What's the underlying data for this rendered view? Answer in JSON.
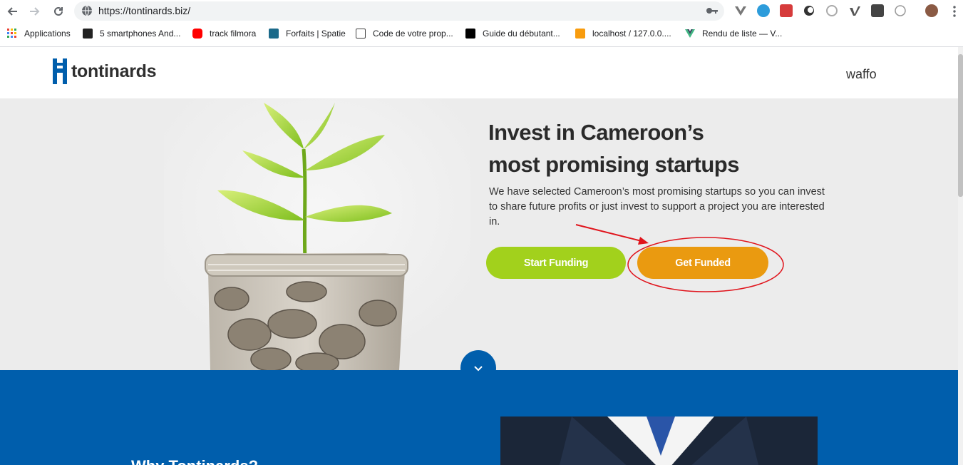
{
  "browser": {
    "url": "https://tontinards.biz/",
    "bookmarks": [
      {
        "label": "Applications",
        "color": "#e94235"
      },
      {
        "label": "5 smartphones And...",
        "color": "#222222"
      },
      {
        "label": "track filmora",
        "color": "#ff0000"
      },
      {
        "label": "Forfaits | Spatie",
        "color": "#1b6a8a"
      },
      {
        "label": "Code de votre prop...",
        "color": "#444444"
      },
      {
        "label": "Guide du débutant...",
        "color": "#000000"
      },
      {
        "label": "localhost / 127.0.0....",
        "color": "#f89c0e"
      },
      {
        "label": "Rendu de liste — V...",
        "color": "#41b883"
      }
    ]
  },
  "header": {
    "logo_text": "tontinards",
    "user_name": "waffo"
  },
  "hero": {
    "title_line1": "Invest in Cameroon’s",
    "title_line2": "most promising startups",
    "description": "We have selected Cameroon’s most promising startups so you can invest to share future profits or just invest to support a project you are interested in.",
    "start_funding": "Start Funding",
    "get_funded": "Get Funded"
  },
  "section": {
    "heading": "Why Tontinards?"
  },
  "colors": {
    "brand_blue": "#005eac",
    "green": "#a2d11c",
    "orange": "#ea9a10",
    "annotation_red": "#e0141c"
  }
}
